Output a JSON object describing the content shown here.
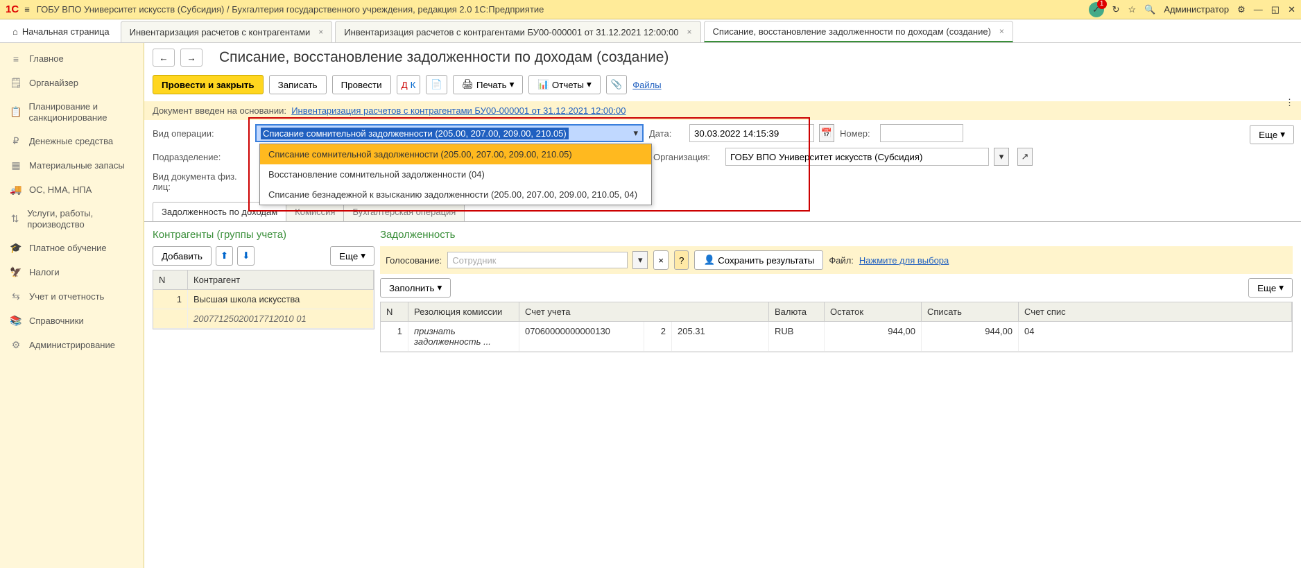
{
  "titlebar": {
    "title": "ГОБУ ВПО Университет искусств (Субсидия) / Бухгалтерия государственного учреждения, редакция 2.0 1С:Предприятие",
    "badge": "1",
    "user": "Администратор"
  },
  "tabs": {
    "home": "Начальная страница",
    "t1": "Инвентаризация расчетов с контрагентами",
    "t2": "Инвентаризация расчетов с контрагентами БУ00-000001 от 31.12.2021 12:00:00",
    "t3": "Списание, восстановление задолженности по доходам (создание)"
  },
  "sidebar": [
    {
      "icon": "≡",
      "label": "Главное"
    },
    {
      "icon": "🗒",
      "label": "Органайзер"
    },
    {
      "icon": "📋",
      "label": "Планирование и санкционирование"
    },
    {
      "icon": "₽",
      "label": "Денежные средства"
    },
    {
      "icon": "▦",
      "label": "Материальные запасы"
    },
    {
      "icon": "🚚",
      "label": "ОС, НМА, НПА"
    },
    {
      "icon": "⇅",
      "label": "Услуги, работы, производство"
    },
    {
      "icon": "🎓",
      "label": "Платное обучение"
    },
    {
      "icon": "🦅",
      "label": "Налоги"
    },
    {
      "icon": "⇆",
      "label": "Учет и отчетность"
    },
    {
      "icon": "📚",
      "label": "Справочники"
    },
    {
      "icon": "⚙",
      "label": "Администрирование"
    }
  ],
  "doc": {
    "title": "Списание, восстановление задолженности по доходам (создание)",
    "btn_post_close": "Провести и закрыть",
    "btn_save": "Записать",
    "btn_post": "Провести",
    "btn_print": "Печать",
    "btn_reports": "Отчеты",
    "link_files": "Файлы",
    "btn_more": "Еще",
    "info_prefix": "Документ введен на основании:",
    "info_link": "Инвентаризация расчетов с контрагентами БУ00-000001 от 31.12.2021 12:00:00",
    "lbl_op": "Вид операции:",
    "val_op": "Списание сомнительной задолженности (205.00, 207.00, 209.00, 210.05)",
    "lbl_date": "Дата:",
    "val_date": "30.03.2022 14:15:39",
    "lbl_num": "Номер:",
    "lbl_dept": "Подразделение:",
    "lbl_org": "Организация:",
    "val_org": "ГОБУ ВПО Университет искусств (Субсидия)",
    "lbl_phys": "Вид документа физ. лиц:",
    "dropdown": [
      "Списание сомнительной задолженности (205.00, 207.00, 209.00, 210.05)",
      "Восстановление сомнительной задолженности (04)",
      "Списание безнадежной к взысканию задолженности (205.00, 207.00, 209.00, 210.05, 04)"
    ],
    "tab_debt": "Задолженность по доходам",
    "tab_comm": "Комиссия",
    "tab_bookop": "Бухгалтерская операция"
  },
  "left": {
    "title": "Контрагенты (группы учета)",
    "btn_add": "Добавить",
    "btn_more": "Еще",
    "col_n": "N",
    "col_cp": "Контрагент",
    "row_n": "1",
    "row_name": "Высшая школа искусства",
    "row_code": "20077125020017712010 01"
  },
  "right": {
    "title": "Задолженность",
    "vote_lbl": "Голосование:",
    "vote_ph": "Сотрудник",
    "save_res": "Сохранить результаты",
    "file_lbl": "Файл:",
    "file_link": "Нажмите для выбора",
    "btn_fill": "Заполнить",
    "btn_more": "Еще",
    "cols": {
      "n": "N",
      "res": "Резолюция комиссии",
      "acc": "Счет учета",
      "cur": "Валюта",
      "bal": "Остаток",
      "write": "Списать",
      "acc2": "Счет спис"
    },
    "row": {
      "n": "1",
      "res": "признать задолженность ...",
      "acc": "07060000000000130",
      "acc_n": "2",
      "acc_sub": "205.31",
      "cur": "RUB",
      "bal": "944,00",
      "write": "944,00",
      "acc2": "04"
    }
  }
}
